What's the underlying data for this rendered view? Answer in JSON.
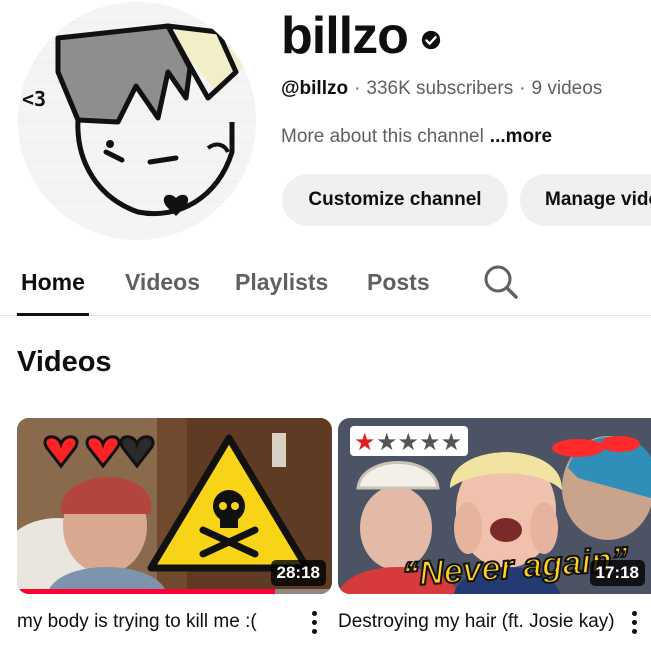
{
  "channel": {
    "name": "billzo",
    "handle": "@billzo",
    "subscribers": "336K subscribers",
    "videos_count": "9 videos",
    "separator": "·",
    "about": "More about this channel",
    "more": "...more",
    "verified_icon": "verified-check-icon"
  },
  "buttons": {
    "customize": "Customize channel",
    "manage": "Manage videos"
  },
  "tabs": [
    {
      "label": "Home",
      "active": true
    },
    {
      "label": "Videos",
      "active": false
    },
    {
      "label": "Playlists",
      "active": false
    },
    {
      "label": "Posts",
      "active": false
    }
  ],
  "search_icon": "search-icon",
  "section": {
    "title": "Videos"
  },
  "videos": [
    {
      "title": "my body is trying to kill me :(",
      "duration": "28:18",
      "watched_fraction": 0.82,
      "thumb_text": ""
    },
    {
      "title": "Destroying my hair (ft. Josie kay)",
      "duration": "17:18",
      "watched_fraction": 0,
      "thumb_text": "“Never again”"
    }
  ],
  "colors": {
    "accent": "#ff0033",
    "text_primary": "#0f0f0f",
    "text_secondary": "#606060",
    "button_bg": "#f0f0f0"
  }
}
